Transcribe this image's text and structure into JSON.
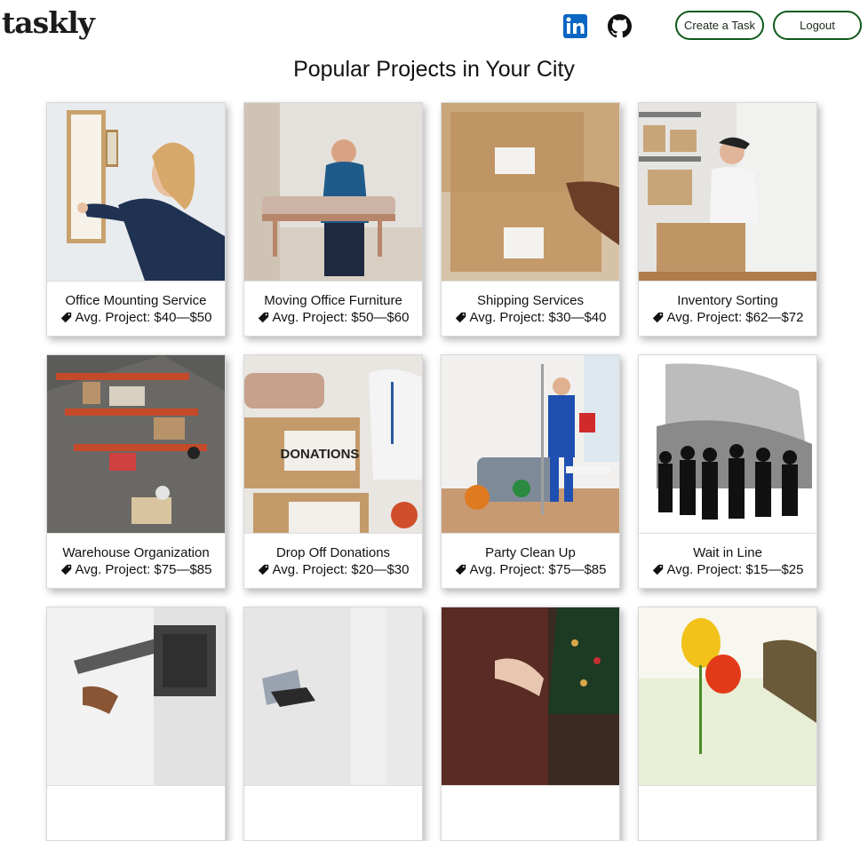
{
  "header": {
    "logo": "taskly",
    "create_label": "Create a Task",
    "logout_label": "Logout"
  },
  "page_title": "Popular Projects in Your City",
  "projects": [
    {
      "title": "Office Mounting Service",
      "price": "Avg. Project: $40—$50",
      "image": "woman-hanging-picture-frame"
    },
    {
      "title": "Moving Office Furniture",
      "price": "Avg. Project: $50—$60",
      "image": "man-carrying-bench"
    },
    {
      "title": "Shipping Services",
      "price": "Avg. Project: $30—$40",
      "image": "hands-holding-boxes"
    },
    {
      "title": "Inventory Sorting",
      "price": "Avg. Project: $62—$72",
      "image": "woman-with-clipboard-warehouse"
    },
    {
      "title": "Warehouse Organization",
      "price": "Avg. Project: $75—$85",
      "image": "warehouse-shelves-aerial"
    },
    {
      "title": "Drop Off Donations",
      "price": "Avg. Project: $20—$30",
      "image": "donation-boxes"
    },
    {
      "title": "Party Clean Up",
      "price": "Avg. Project: $75—$85",
      "image": "cleaner-messy-living-room"
    },
    {
      "title": "Wait in Line",
      "price": "Avg. Project: $15—$25",
      "image": "crowd-silhouettes-queue"
    },
    {
      "title": "",
      "price": "",
      "image": "tv-wall-mount"
    },
    {
      "title": "",
      "price": "",
      "image": "drill-assembly"
    },
    {
      "title": "",
      "price": "",
      "image": "christmas-tree-decorating"
    },
    {
      "title": "",
      "price": "",
      "image": "tulips-gardening-glove"
    }
  ]
}
